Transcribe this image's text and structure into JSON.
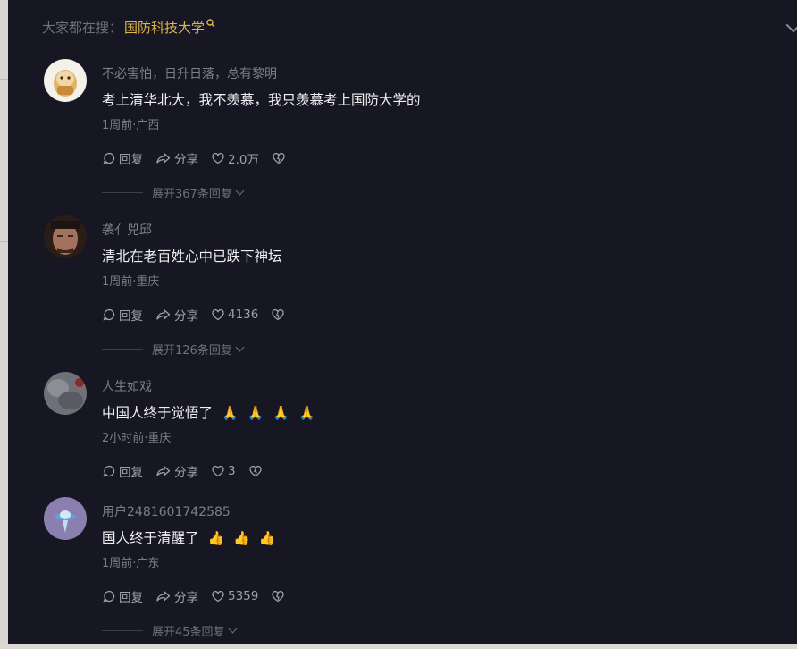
{
  "search": {
    "prefix": "大家都在搜：",
    "term": "国防科技大学",
    "icon": "search-icon"
  },
  "actions": {
    "reply_label": "回复",
    "share_label": "分享"
  },
  "comments": [
    {
      "username": "不必害怕，日升日落，总有黎明",
      "content": "考上清华北大，我不羡慕，我只羡慕考上国防大学的",
      "meta": "1周前·广西",
      "likes": "2.0万",
      "expand": "展开367条回复",
      "avatar_colors": [
        "#e9d2a6",
        "#a9762e"
      ]
    },
    {
      "username": "袭亻兕邱",
      "content": "清北在老百姓心中已跌下神坛",
      "meta": "1周前·重庆",
      "likes": "4136",
      "expand": "展开126条回复",
      "avatar_colors": [
        "#a4715c",
        "#2a1d18"
      ]
    },
    {
      "username": "人生如戏",
      "content": "中国人终于觉悟了",
      "emoji": [
        "🙏",
        "🙏",
        "🙏",
        "🙏"
      ],
      "meta": "2小时前·重庆",
      "likes": "3",
      "expand": "",
      "avatar_colors": [
        "#707078",
        "#4b1c1c"
      ]
    },
    {
      "username": "用户2481601742585",
      "content": "国人终于清醒了",
      "emoji": [
        "👍",
        "👍",
        "👍"
      ],
      "meta": "1周前·广东",
      "likes": "5359",
      "expand": "展开45条回复",
      "avatar_colors": [
        "#8a7fae",
        "#5fa3d6"
      ]
    }
  ],
  "colors": {
    "background": "#161722",
    "accent": "#e2b54a",
    "text_primary": "#f0f0f3",
    "text_secondary": "#7d7e88"
  }
}
